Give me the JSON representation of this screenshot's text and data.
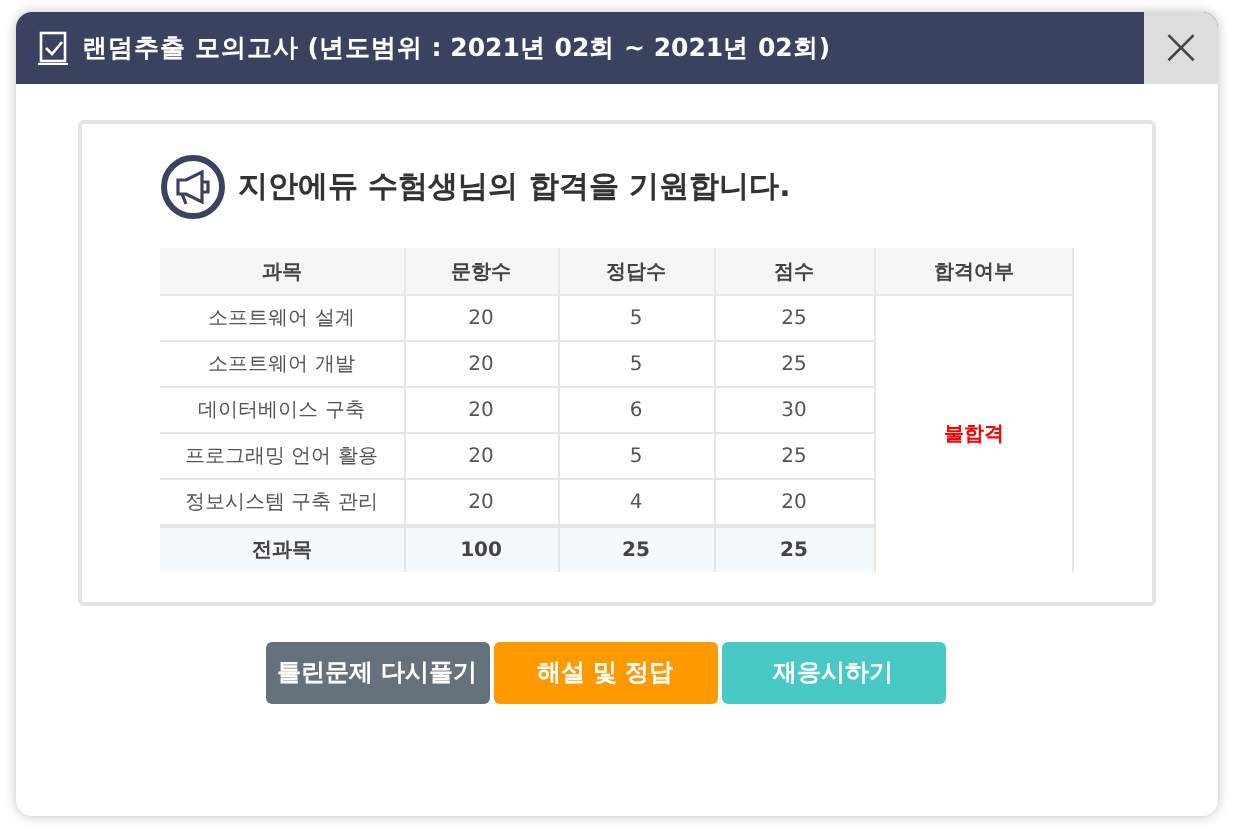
{
  "window": {
    "title": "랜덤추출 모의고사 (년도범위 : 2021년 02회 ~ 2021년 02회)",
    "close": "×"
  },
  "message": "지안에듀 수험생님의 합격을 기원합니다.",
  "table": {
    "columns": [
      "과목",
      "문항수",
      "정답수",
      "점수",
      "합격여부"
    ],
    "rows": [
      {
        "subject": "소프트웨어 설계",
        "questions": "20",
        "correct": "5",
        "score": "25"
      },
      {
        "subject": "소프트웨어 개발",
        "questions": "20",
        "correct": "5",
        "score": "25"
      },
      {
        "subject": "데이터베이스 구축",
        "questions": "20",
        "correct": "6",
        "score": "30"
      },
      {
        "subject": "프로그래밍 언어 활용",
        "questions": "20",
        "correct": "5",
        "score": "25"
      },
      {
        "subject": "정보시스템 구축 관리",
        "questions": "20",
        "correct": "4",
        "score": "20"
      }
    ],
    "total": {
      "subject": "전과목",
      "questions": "100",
      "correct": "25",
      "score": "25"
    },
    "result": {
      "label": "불합격",
      "passed": false
    }
  },
  "buttons": [
    {
      "label": "틀린문제 다시풀기",
      "kind": "retry"
    },
    {
      "label": "해설 및 정답",
      "kind": "answers"
    },
    {
      "label": "재응시하기",
      "kind": "retake"
    }
  ]
}
